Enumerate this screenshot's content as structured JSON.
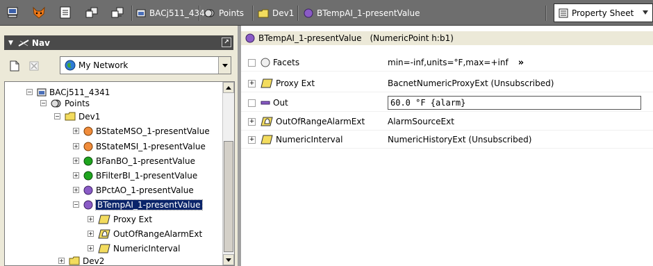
{
  "toolbar": {
    "breadcrumbs": [
      {
        "label": "BACj511_4341",
        "icon": "device-icon"
      },
      {
        "label": "Points",
        "icon": "points-icon"
      },
      {
        "label": "Dev1",
        "icon": "folder-icon"
      },
      {
        "label": "BTempAI_1-presentValue",
        "icon": "point-icon"
      }
    ],
    "view_selector": "Property Sheet"
  },
  "nav": {
    "title": "Nav",
    "network_select": "My Network",
    "tree": [
      {
        "label": "BACj511_4341",
        "icon": "device-icon",
        "expander": "−"
      },
      {
        "label": "Points",
        "icon": "points-icon",
        "expander": "−"
      },
      {
        "label": "Dev1",
        "icon": "folder-icon",
        "expander": "−"
      },
      {
        "label": "BStateMSO_1-presentValue",
        "icon": "point-orange-icon",
        "expander": "+"
      },
      {
        "label": "BStateMSI_1-presentValue",
        "icon": "point-orange-icon",
        "expander": "+"
      },
      {
        "label": "BFanBO_1-presentValue",
        "icon": "point-green-icon",
        "expander": "+"
      },
      {
        "label": "BFilterBI_1-presentValue",
        "icon": "point-green-icon",
        "expander": "+"
      },
      {
        "label": "BPctAO_1-presentValue",
        "icon": "point-purple-icon",
        "expander": "+"
      },
      {
        "label": "BTempAI_1-presentValue",
        "icon": "point-purple-icon",
        "expander": "−",
        "selected": true
      },
      {
        "label": "Proxy Ext",
        "icon": "proxy-ext-icon",
        "expander": "+"
      },
      {
        "label": "OutOfRangeAlarmExt",
        "icon": "alarm-ext-icon",
        "expander": "+"
      },
      {
        "label": "NumericInterval",
        "icon": "proxy-ext-icon",
        "expander": "+"
      },
      {
        "label": "Dev2",
        "icon": "folder-icon",
        "expander": "+"
      }
    ]
  },
  "sheet": {
    "header_name": "BTempAI_1-presentValue",
    "header_type": "(NumericPoint h:b1)",
    "rows": [
      {
        "name": "Facets",
        "value": "min=-inf,units=°F,max=+inf",
        "more": "»",
        "icon": "facets-icon",
        "toggle": ""
      },
      {
        "name": "Proxy Ext",
        "value": "BacnetNumericProxyExt (Unsubscribed)",
        "icon": "proxy-ext-icon",
        "toggle": "+"
      },
      {
        "name": "Out",
        "value": "60.0 °F {alarm}",
        "icon": "out-icon",
        "toggle": ""
      },
      {
        "name": "OutOfRangeAlarmExt",
        "value": "AlarmSourceExt",
        "icon": "alarm-ext-icon",
        "toggle": "+"
      },
      {
        "name": "NumericInterval",
        "value": "NumericHistoryExt (Unsubscribed)",
        "icon": "proxy-ext-icon",
        "toggle": "+"
      }
    ]
  },
  "colors": {
    "toolbar_bg": "#6e6e6e",
    "selection": "#0a246a",
    "point_orange": "#f08c3c",
    "point_green": "#1fa51f",
    "point_purple": "#8a5bc6",
    "folder_yellow": "#f3dc5e"
  }
}
